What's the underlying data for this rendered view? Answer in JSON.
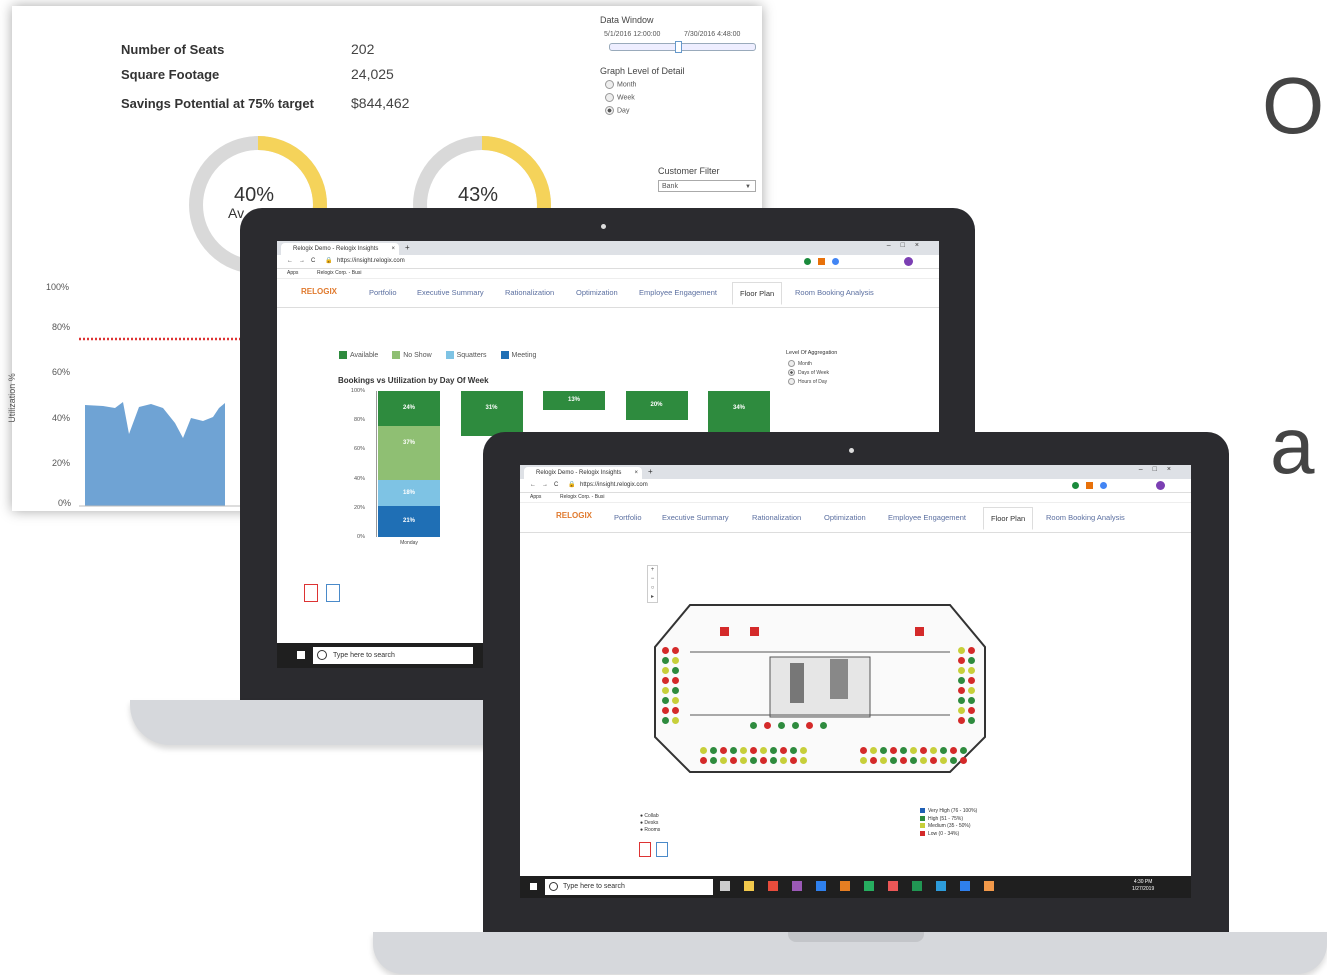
{
  "colors": {
    "available": "#2e8b3e",
    "no_show": "#8fbf73",
    "squatters": "#7ec3e4",
    "meeting": "#1f6fb5",
    "gauge_yellow": "#f5d35a",
    "gauge_grey": "#d9d9d9",
    "area_blue": "#6fa3d4",
    "target_red": "#d33",
    "very_high": "#1f5fb5",
    "high": "#2e8b3e",
    "medium": "#c7cf3a",
    "low": "#d42a2a"
  },
  "dashboard": {
    "stats": [
      {
        "label": "Number of Seats",
        "value": "202"
      },
      {
        "label": "Square Footage",
        "value": "24,025"
      },
      {
        "label": "Savings Potential at 75% target",
        "value": "$844,462"
      }
    ],
    "data_window": {
      "title": "Data Window",
      "start": "5/1/2016 12:00:00",
      "end": "7/30/2016 4:48:00"
    },
    "graph_level": {
      "title": "Graph Level of Detail",
      "options": [
        "Month",
        "Week",
        "Day"
      ],
      "selected": "Day"
    },
    "customer_filter": {
      "title": "Customer Filter",
      "value": "Bank"
    },
    "gauges": [
      {
        "value": "40%",
        "label": "Av",
        "fill": 40
      },
      {
        "value": "43%",
        "fill": 43
      }
    ],
    "area_chart": {
      "ylabel": "Utilization %",
      "yticks": [
        "100%",
        "80%",
        "60%",
        "40%",
        "20%",
        "0%"
      ]
    }
  },
  "side_text": {
    "letter1": "O",
    "letter2": "a"
  },
  "laptop1": {
    "tab_title": "Relogix Demo - Relogix Insights",
    "url": "https://insight.relogix.com",
    "bookmarks": [
      "Apps",
      "Relogix Corp. - Busi"
    ],
    "logo": "RELOGIX",
    "nav": [
      "Portfolio",
      "Executive Summary",
      "Rationalization",
      "Optimization",
      "Employee Engagement",
      "Floor Plan",
      "Room Booking Analysis"
    ],
    "legend": [
      "Available",
      "No Show",
      "Squatters",
      "Meeting"
    ],
    "chart_title": "Bookings vs Utilization by Day Of Week",
    "aggregation": {
      "title": "Level Of Aggregation",
      "options": [
        "Month",
        "Days of Week",
        "Hours of Day"
      ],
      "selected": "Days of Week"
    },
    "taskbar_search": "Type here to search"
  },
  "laptop2": {
    "tab_title": "Relogix Demo - Relogix Insights",
    "url": "https://insight.relogix.com",
    "bookmarks": [
      "Apps",
      "Relogix Corp. - Busi"
    ],
    "logo": "RELOGIX",
    "nav": [
      "Portfolio",
      "Executive Summary",
      "Rationalization",
      "Optimization",
      "Employee Engagement",
      "Floor Plan",
      "Room Booking Analysis"
    ],
    "floor_legend_left": [
      "Collab",
      "Desks",
      "Rooms"
    ],
    "floor_legend_right": [
      "Very High (76 - 100%)",
      "High (51 - 75%)",
      "Medium (35 - 50%)",
      "Low (0 - 34%)"
    ],
    "taskbar_search": "Type here to search",
    "clock": {
      "time": "4:30 PM",
      "date": "1/27/2019"
    }
  },
  "chart_data": {
    "type": "bar",
    "title": "Bookings vs Utilization by Day Of Week",
    "categories": [
      "Monday",
      "",
      "",
      "",
      ""
    ],
    "series": [
      {
        "name": "Meeting",
        "values": [
          21,
          null,
          null,
          null,
          null
        ]
      },
      {
        "name": "Squatters",
        "values": [
          18,
          null,
          null,
          null,
          null
        ]
      },
      {
        "name": "No Show",
        "values": [
          37,
          null,
          null,
          null,
          null
        ]
      },
      {
        "name": "Available",
        "values": [
          24,
          31,
          13,
          20,
          34
        ]
      }
    ],
    "yticks": [
      "100%",
      "80%",
      "60%",
      "40%",
      "20%",
      "0%"
    ],
    "ylim": [
      0,
      100
    ]
  }
}
